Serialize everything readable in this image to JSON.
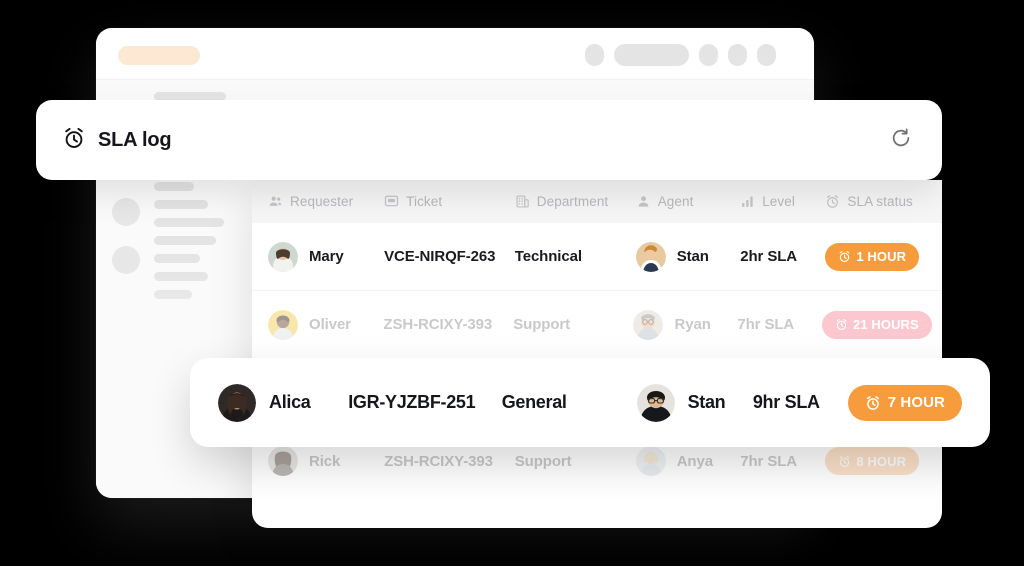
{
  "window": {
    "topbar": {
      "brand_pill": "",
      "nav_placeholder_1": "",
      "nav_placeholder_2": "",
      "nav_placeholder_3": "",
      "nav_placeholder_4": "",
      "nav_placeholder_5": ""
    }
  },
  "panel": {
    "title": "SLA log",
    "title_icon": "alarm-clock-icon",
    "refresh_icon": "refresh-icon"
  },
  "table": {
    "columns": [
      {
        "key": "requester",
        "label": "Requester",
        "icon": "users-icon"
      },
      {
        "key": "ticket",
        "label": "Ticket",
        "icon": "message-square-icon"
      },
      {
        "key": "department",
        "label": "Department",
        "icon": "building-icon"
      },
      {
        "key": "agent",
        "label": "Agent",
        "icon": "user-icon"
      },
      {
        "key": "level",
        "label": "Level",
        "icon": "bar-chart-icon"
      },
      {
        "key": "sla_status",
        "label": "SLA status",
        "icon": "alarm-clock-icon"
      }
    ],
    "rows": [
      {
        "requester": "Mary",
        "ticket": "VCE-NIRQF-263",
        "department": "Technical",
        "agent": "Stan",
        "level": "2hr SLA",
        "sla_status": "1 HOUR",
        "sla_style": "orange",
        "state": "normal"
      },
      {
        "requester": "Oliver",
        "ticket": "ZSH-RCIXY-393",
        "department": "Support",
        "agent": "Ryan",
        "level": "7hr SLA",
        "sla_status": "21 HOURS",
        "sla_style": "pink",
        "state": "faded"
      },
      {
        "requester": "Rick",
        "ticket": "ZSH-RCIXY-393",
        "department": "Support",
        "agent": "Anya",
        "level": "7hr SLA",
        "sla_status": "8 HOUR",
        "sla_style": "orange-soft",
        "state": "faded"
      }
    ],
    "highlighted_row": {
      "requester": "Alica",
      "ticket": "IGR-YJZBF-251",
      "department": "General",
      "agent": "Stan",
      "level": "9hr SLA",
      "sla_status": "7 HOUR",
      "sla_style": "orange"
    }
  },
  "colors": {
    "accent_orange": "#F79C3D",
    "accent_orange_soft": "#F9BE8C",
    "accent_pink": "#FA8699",
    "brand_pill": "#FDE8D4",
    "header_bg": "#F6F6F6",
    "text_strong": "#1A1B20",
    "text_muted": "#8B8B90",
    "header_text": "#B9B9BD",
    "page_bg": "#000000"
  }
}
